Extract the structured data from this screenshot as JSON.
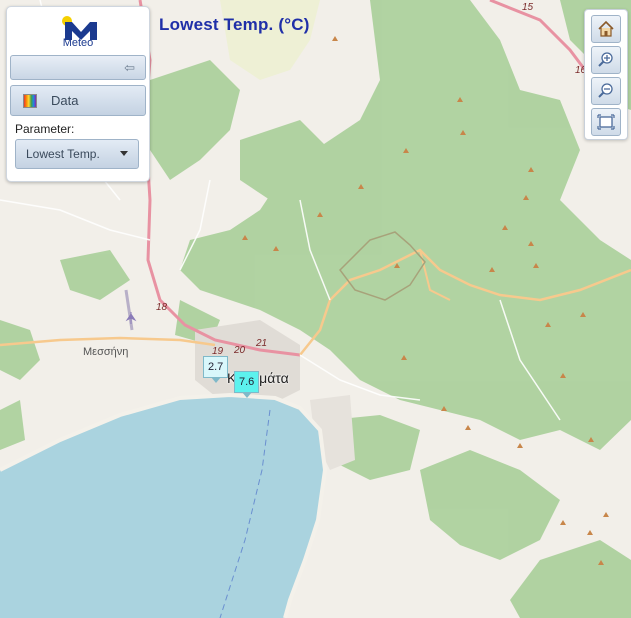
{
  "map": {
    "title": "Lowest Temp. (°C)",
    "places": {
      "messini": "Μεσσήνη",
      "kalamata": "Καλαμάτα"
    },
    "road_numbers": [
      "15",
      "16",
      "18",
      "19",
      "20",
      "21"
    ]
  },
  "panel": {
    "logo_text": "Meteo",
    "data_label": "Data",
    "parameter_label": "Parameter:",
    "parameter_value": "Lowest Temp."
  },
  "markers": [
    {
      "value": "2.7",
      "color": "#d9f7fb"
    },
    {
      "value": "7.6",
      "color": "#5cf2ee"
    }
  ],
  "toolbar": {
    "home": "home-icon",
    "zoom_in": "zoom-in-icon",
    "zoom_out": "zoom-out-icon",
    "extent": "full-extent-icon"
  },
  "colors": {
    "land": "#f2efe9",
    "forest": "#add19e",
    "sea": "#aad3df",
    "title": "#1f2fa8",
    "major_road": "#e892a2",
    "secondary_road": "#f7c98d"
  }
}
